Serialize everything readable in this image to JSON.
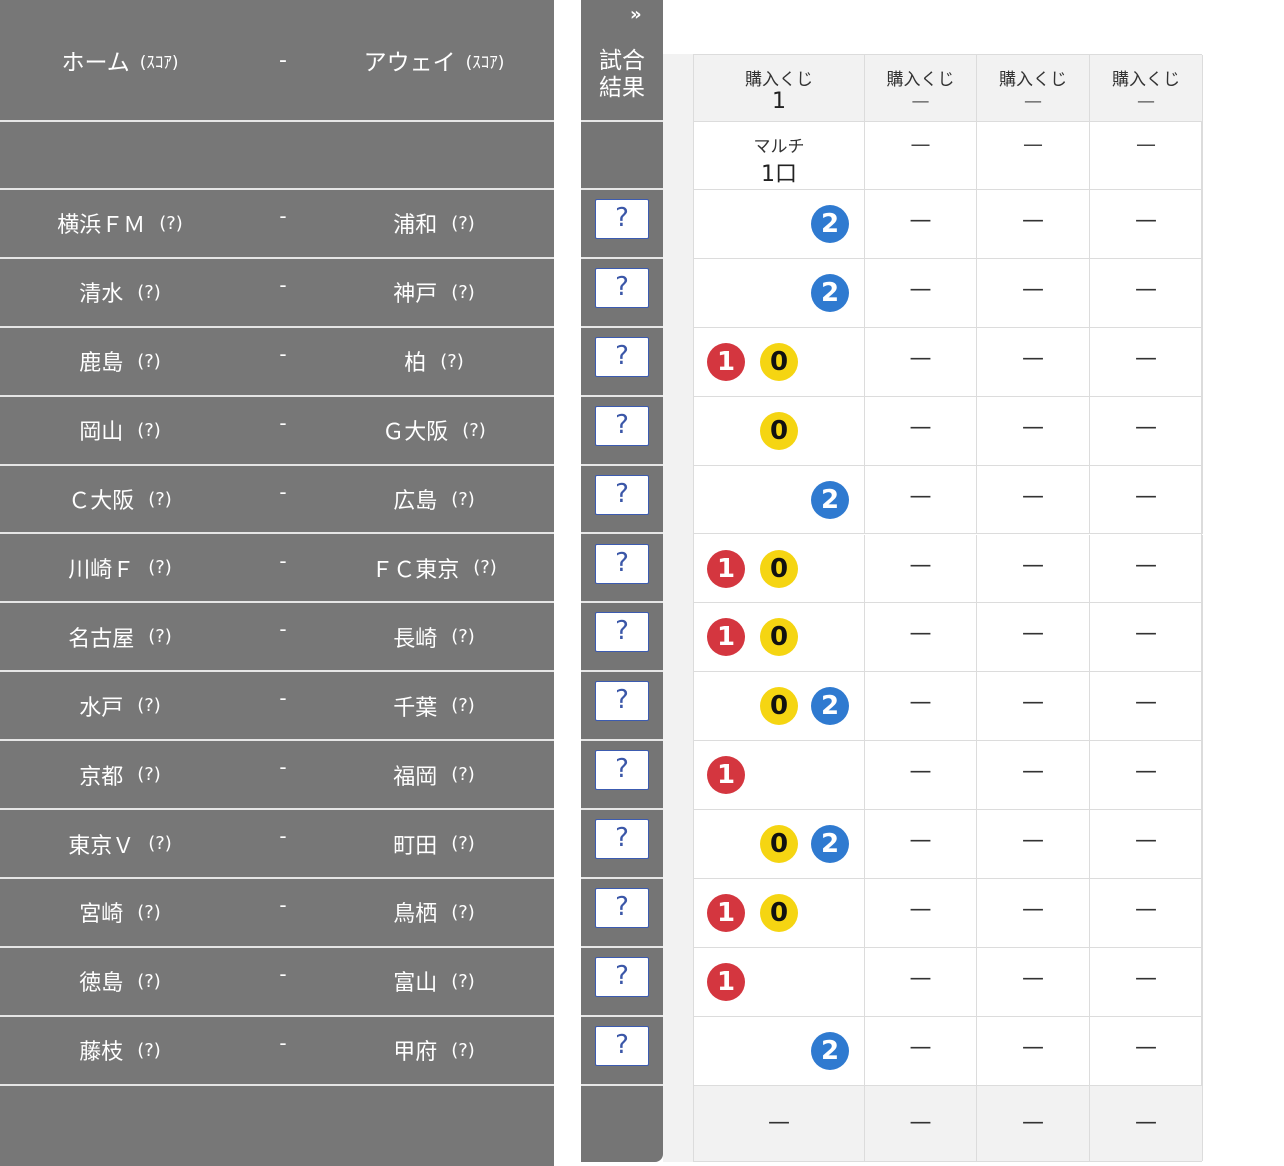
{
  "left_header": {
    "home_label": "ホーム",
    "home_score_label": "(ｽｺｱ)",
    "separator": "-",
    "away_label": "アウェイ",
    "away_score_label": "(ｽｺｱ)"
  },
  "result_column": {
    "expand_icon": "double-chevron-right-icon",
    "expand_glyph": "»",
    "title_line1": "試合",
    "title_line2": "結果",
    "result_placeholder": "?"
  },
  "matches": [
    {
      "home": "横浜ＦＭ",
      "home_score": "(?)",
      "sep": "-",
      "away": "浦和",
      "away_score": "(?)",
      "result": "?",
      "picks": [
        "2"
      ]
    },
    {
      "home": "清水",
      "home_score": "(?)",
      "sep": "-",
      "away": "神戸",
      "away_score": "(?)",
      "result": "?",
      "picks": [
        "2"
      ]
    },
    {
      "home": "鹿島",
      "home_score": "(?)",
      "sep": "-",
      "away": "柏",
      "away_score": "(?)",
      "result": "?",
      "picks": [
        "1",
        "0"
      ]
    },
    {
      "home": "岡山",
      "home_score": "(?)",
      "sep": "-",
      "away": "Ｇ大阪",
      "away_score": "(?)",
      "result": "?",
      "picks": [
        "0"
      ]
    },
    {
      "home": "Ｃ大阪",
      "home_score": "(?)",
      "sep": "-",
      "away": "広島",
      "away_score": "(?)",
      "result": "?",
      "picks": [
        "2"
      ]
    },
    {
      "home": "川崎Ｆ",
      "home_score": "(?)",
      "sep": "-",
      "away": "ＦＣ東京",
      "away_score": "(?)",
      "result": "?",
      "picks": [
        "1",
        "0"
      ]
    },
    {
      "home": "名古屋",
      "home_score": "(?)",
      "sep": "-",
      "away": "長崎",
      "away_score": "(?)",
      "result": "?",
      "picks": [
        "1",
        "0"
      ]
    },
    {
      "home": "水戸",
      "home_score": "(?)",
      "sep": "-",
      "away": "千葉",
      "away_score": "(?)",
      "result": "?",
      "picks": [
        "0",
        "2"
      ]
    },
    {
      "home": "京都",
      "home_score": "(?)",
      "sep": "-",
      "away": "福岡",
      "away_score": "(?)",
      "result": "?",
      "picks": [
        "1"
      ]
    },
    {
      "home": "東京Ｖ",
      "home_score": "(?)",
      "sep": "-",
      "away": "町田",
      "away_score": "(?)",
      "result": "?",
      "picks": [
        "0",
        "2"
      ]
    },
    {
      "home": "宮崎",
      "home_score": "(?)",
      "sep": "-",
      "away": "鳥栖",
      "away_score": "(?)",
      "result": "?",
      "picks": [
        "1",
        "0"
      ]
    },
    {
      "home": "徳島",
      "home_score": "(?)",
      "sep": "-",
      "away": "富山",
      "away_score": "(?)",
      "result": "?",
      "picks": [
        "1"
      ]
    },
    {
      "home": "藤枝",
      "home_score": "(?)",
      "sep": "-",
      "away": "甲府",
      "away_score": "(?)",
      "result": "?",
      "picks": [
        "2"
      ]
    }
  ],
  "tickets": [
    {
      "label": "購入くじ",
      "number": "1",
      "type": "マルチ",
      "units": "1口",
      "footer": "—"
    },
    {
      "label": "購入くじ",
      "number": "—",
      "type": "—",
      "units": "",
      "footer": "—"
    },
    {
      "label": "購入くじ",
      "number": "—",
      "type": "—",
      "units": "",
      "footer": "—"
    },
    {
      "label": "購入くじ",
      "number": "—",
      "type": "—",
      "units": "",
      "footer": "—"
    }
  ],
  "empty_pick": "—",
  "pick_colors": {
    "1": "#d4363f",
    "0": "#f5d512",
    "2": "#2f7ad0"
  }
}
